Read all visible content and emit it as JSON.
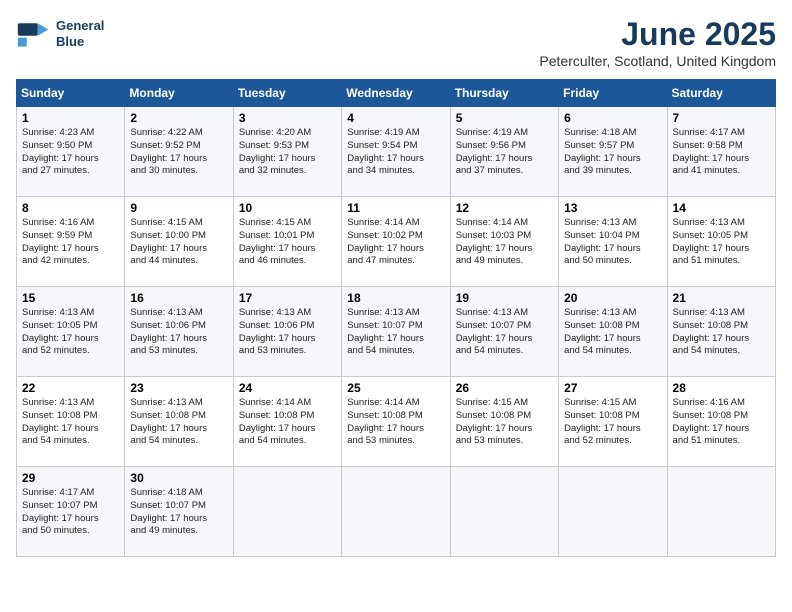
{
  "header": {
    "logo_line1": "General",
    "logo_line2": "Blue",
    "title": "June 2025",
    "subtitle": "Peterculter, Scotland, United Kingdom"
  },
  "days_of_week": [
    "Sunday",
    "Monday",
    "Tuesday",
    "Wednesday",
    "Thursday",
    "Friday",
    "Saturday"
  ],
  "weeks": [
    [
      {
        "day": "1",
        "info": "Sunrise: 4:23 AM\nSunset: 9:50 PM\nDaylight: 17 hours\nand 27 minutes."
      },
      {
        "day": "2",
        "info": "Sunrise: 4:22 AM\nSunset: 9:52 PM\nDaylight: 17 hours\nand 30 minutes."
      },
      {
        "day": "3",
        "info": "Sunrise: 4:20 AM\nSunset: 9:53 PM\nDaylight: 17 hours\nand 32 minutes."
      },
      {
        "day": "4",
        "info": "Sunrise: 4:19 AM\nSunset: 9:54 PM\nDaylight: 17 hours\nand 34 minutes."
      },
      {
        "day": "5",
        "info": "Sunrise: 4:19 AM\nSunset: 9:56 PM\nDaylight: 17 hours\nand 37 minutes."
      },
      {
        "day": "6",
        "info": "Sunrise: 4:18 AM\nSunset: 9:57 PM\nDaylight: 17 hours\nand 39 minutes."
      },
      {
        "day": "7",
        "info": "Sunrise: 4:17 AM\nSunset: 9:58 PM\nDaylight: 17 hours\nand 41 minutes."
      }
    ],
    [
      {
        "day": "8",
        "info": "Sunrise: 4:16 AM\nSunset: 9:59 PM\nDaylight: 17 hours\nand 42 minutes."
      },
      {
        "day": "9",
        "info": "Sunrise: 4:15 AM\nSunset: 10:00 PM\nDaylight: 17 hours\nand 44 minutes."
      },
      {
        "day": "10",
        "info": "Sunrise: 4:15 AM\nSunset: 10:01 PM\nDaylight: 17 hours\nand 46 minutes."
      },
      {
        "day": "11",
        "info": "Sunrise: 4:14 AM\nSunset: 10:02 PM\nDaylight: 17 hours\nand 47 minutes."
      },
      {
        "day": "12",
        "info": "Sunrise: 4:14 AM\nSunset: 10:03 PM\nDaylight: 17 hours\nand 49 minutes."
      },
      {
        "day": "13",
        "info": "Sunrise: 4:13 AM\nSunset: 10:04 PM\nDaylight: 17 hours\nand 50 minutes."
      },
      {
        "day": "14",
        "info": "Sunrise: 4:13 AM\nSunset: 10:05 PM\nDaylight: 17 hours\nand 51 minutes."
      }
    ],
    [
      {
        "day": "15",
        "info": "Sunrise: 4:13 AM\nSunset: 10:05 PM\nDaylight: 17 hours\nand 52 minutes."
      },
      {
        "day": "16",
        "info": "Sunrise: 4:13 AM\nSunset: 10:06 PM\nDaylight: 17 hours\nand 53 minutes."
      },
      {
        "day": "17",
        "info": "Sunrise: 4:13 AM\nSunset: 10:06 PM\nDaylight: 17 hours\nand 53 minutes."
      },
      {
        "day": "18",
        "info": "Sunrise: 4:13 AM\nSunset: 10:07 PM\nDaylight: 17 hours\nand 54 minutes."
      },
      {
        "day": "19",
        "info": "Sunrise: 4:13 AM\nSunset: 10:07 PM\nDaylight: 17 hours\nand 54 minutes."
      },
      {
        "day": "20",
        "info": "Sunrise: 4:13 AM\nSunset: 10:08 PM\nDaylight: 17 hours\nand 54 minutes."
      },
      {
        "day": "21",
        "info": "Sunrise: 4:13 AM\nSunset: 10:08 PM\nDaylight: 17 hours\nand 54 minutes."
      }
    ],
    [
      {
        "day": "22",
        "info": "Sunrise: 4:13 AM\nSunset: 10:08 PM\nDaylight: 17 hours\nand 54 minutes."
      },
      {
        "day": "23",
        "info": "Sunrise: 4:13 AM\nSunset: 10:08 PM\nDaylight: 17 hours\nand 54 minutes."
      },
      {
        "day": "24",
        "info": "Sunrise: 4:14 AM\nSunset: 10:08 PM\nDaylight: 17 hours\nand 54 minutes."
      },
      {
        "day": "25",
        "info": "Sunrise: 4:14 AM\nSunset: 10:08 PM\nDaylight: 17 hours\nand 53 minutes."
      },
      {
        "day": "26",
        "info": "Sunrise: 4:15 AM\nSunset: 10:08 PM\nDaylight: 17 hours\nand 53 minutes."
      },
      {
        "day": "27",
        "info": "Sunrise: 4:15 AM\nSunset: 10:08 PM\nDaylight: 17 hours\nand 52 minutes."
      },
      {
        "day": "28",
        "info": "Sunrise: 4:16 AM\nSunset: 10:08 PM\nDaylight: 17 hours\nand 51 minutes."
      }
    ],
    [
      {
        "day": "29",
        "info": "Sunrise: 4:17 AM\nSunset: 10:07 PM\nDaylight: 17 hours\nand 50 minutes."
      },
      {
        "day": "30",
        "info": "Sunrise: 4:18 AM\nSunset: 10:07 PM\nDaylight: 17 hours\nand 49 minutes."
      },
      {
        "day": "",
        "info": ""
      },
      {
        "day": "",
        "info": ""
      },
      {
        "day": "",
        "info": ""
      },
      {
        "day": "",
        "info": ""
      },
      {
        "day": "",
        "info": ""
      }
    ]
  ]
}
